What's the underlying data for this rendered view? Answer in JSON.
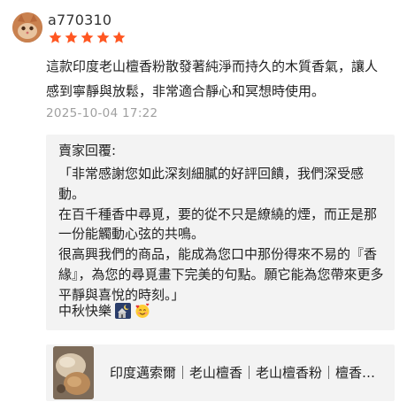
{
  "review": {
    "username": "a770310",
    "rating": 5,
    "text": "這款印度老山檀香粉散發著純淨而持久的木質香氣，讓人感到寧靜與放鬆，非常適合靜心和冥想時使用。",
    "date": "2025-10-04 17:22"
  },
  "reply": {
    "title": "賣家回覆:",
    "body": "「非常感謝您如此深刻細膩的好評回饋，我們深受感動。\n在百千種香中尋覓，要的從不只是繚繞的煙，而正是那一份能觸動心弦的共鳴。\n很高興我們的商品，能成為您口中那份得來不易的『香緣』，為您的尋覓畫下完美的句點。願它能為您帶來更多平靜與喜悅的時刻。」",
    "signoff": "中秋快樂"
  },
  "product": {
    "title": "印度邁索爾｜老山檀香｜老山檀香粉｜檀香粉｜香粉"
  },
  "icons": {
    "avatar": "cat-avatar-icon",
    "star": "star-icon",
    "emoji_1": "moon-house-emoji-icon",
    "emoji_2": "smiling-hearts-emoji-icon"
  },
  "colors": {
    "star": "#ff5722",
    "date": "#a0a0a0",
    "reply_bg": "#f3f3f3"
  }
}
